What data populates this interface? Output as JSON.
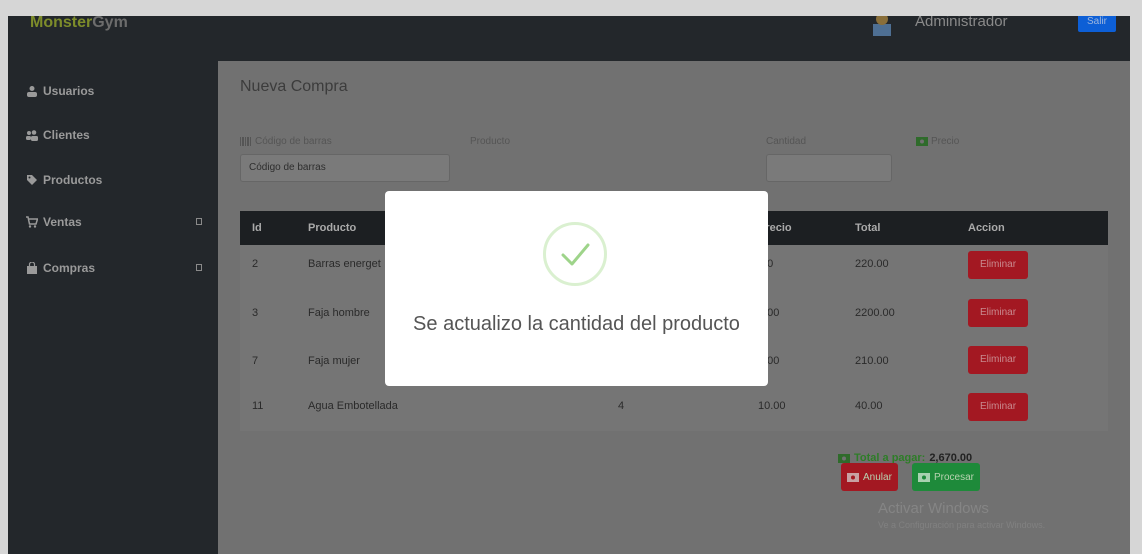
{
  "app": {
    "brand_part1": "Monster",
    "brand_part2": "Gym",
    "user_name": "Administrador",
    "logout_label": "Salir"
  },
  "sidebar": {
    "items": [
      {
        "label": "Usuarios",
        "icon": "user-icon",
        "has_caret": false
      },
      {
        "label": "Clientes",
        "icon": "users-icon",
        "has_caret": false
      },
      {
        "label": "Productos",
        "icon": "tag-icon",
        "has_caret": false
      },
      {
        "label": "Ventas",
        "icon": "cart-icon",
        "has_caret": true
      },
      {
        "label": "Compras",
        "icon": "bag-icon",
        "has_caret": true
      }
    ]
  },
  "form": {
    "title": "Nueva Compra",
    "barcode_label": "Código de barras",
    "barcode_placeholder": "Código de barras",
    "product_label": "Producto",
    "quantity_label": "Cantidad",
    "price_label": "Precio"
  },
  "table": {
    "headers": [
      "Id",
      "Producto",
      "Precio",
      "Total",
      "Accion"
    ],
    "rows": [
      {
        "id": "2",
        "product": "Barras energet",
        "quantity": "",
        "price": ".00",
        "total": "220.00",
        "action": "Eliminar"
      },
      {
        "id": "3",
        "product": "Faja hombre",
        "quantity": "",
        "price": "0.00",
        "total": "2200.00",
        "action": "Eliminar"
      },
      {
        "id": "7",
        "product": "Faja mujer",
        "quantity": "",
        "price": "0.00",
        "total": "210.00",
        "action": "Eliminar"
      },
      {
        "id": "11",
        "product": "Agua Embotellada",
        "quantity": "4",
        "price": "10.00",
        "total": "40.00",
        "action": "Eliminar"
      }
    ]
  },
  "summary": {
    "total_label": "Total a pagar:",
    "total_value": "2,670.00",
    "cancel_label": "Anular",
    "process_label": "Procesar"
  },
  "watermark": {
    "title": "Activar Windows",
    "subtitle": "Ve a Configuración para activar Windows."
  },
  "modal": {
    "icon": "check-circle-icon",
    "message": "Se actualizo la cantidad del producto"
  },
  "colors": {
    "danger": "#a31822",
    "success": "#1e8a3a",
    "primary": "#0d5fd6",
    "sidebar": "#23272b"
  }
}
